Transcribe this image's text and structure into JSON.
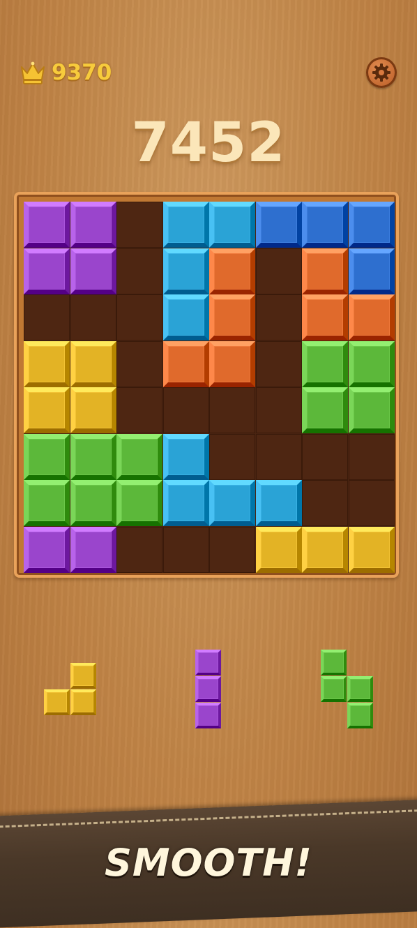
{
  "header": {
    "best_score": "9370",
    "crown_icon": "crown-icon",
    "settings_icon": "gear-icon"
  },
  "score": "7452",
  "board": {
    "rows": 8,
    "cols": 8,
    "cells": [
      [
        "purple",
        "purple",
        "",
        "cyan",
        "cyan",
        "blue",
        "blue",
        "blue"
      ],
      [
        "purple",
        "purple",
        "",
        "cyan",
        "orange",
        "",
        "orange",
        "blue"
      ],
      [
        "",
        "",
        "",
        "cyan",
        "orange",
        "",
        "orange",
        "orange"
      ],
      [
        "yellow",
        "yellow",
        "",
        "orange",
        "orange",
        "",
        "green",
        "green"
      ],
      [
        "yellow",
        "yellow",
        "",
        "",
        "",
        "",
        "green",
        "green"
      ],
      [
        "green",
        "green",
        "green",
        "cyan",
        "",
        "",
        "",
        ""
      ],
      [
        "green",
        "green",
        "green",
        "cyan",
        "cyan",
        "cyan",
        "",
        ""
      ],
      [
        "purple",
        "purple",
        "",
        "",
        "",
        "yellow",
        "yellow",
        "yellow"
      ]
    ]
  },
  "tray": [
    {
      "color": "yellow",
      "cells": [
        [
          0,
          1
        ],
        [
          1,
          0
        ],
        [
          1,
          1
        ]
      ]
    },
    {
      "color": "purple",
      "cells": [
        [
          0,
          0
        ],
        [
          1,
          0
        ],
        [
          2,
          0
        ]
      ]
    },
    {
      "color": "green",
      "cells": [
        [
          0,
          0
        ],
        [
          1,
          0
        ],
        [
          1,
          1
        ],
        [
          2,
          1
        ]
      ]
    }
  ],
  "colors": {
    "purple": "#9a45cc",
    "cyan": "#2aa3d6",
    "blue": "#2e6fcf",
    "orange": "#e06a2c",
    "yellow": "#e3b325",
    "green": "#5cb83a",
    "accent_gold": "#f7cb3c"
  },
  "banner": {
    "text": "SMOOTH!"
  }
}
